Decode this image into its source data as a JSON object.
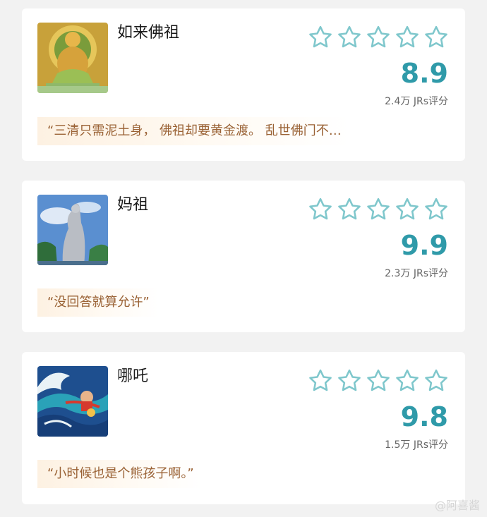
{
  "cards": [
    {
      "name": "如来佛祖",
      "score": "8.9",
      "rating_count": "2.4万 JRs评分",
      "quote": "“三清只需泥土身， 佛祖却要黄金渡。 乱世佛门不…",
      "stars_filled": 0,
      "stars_total": 5,
      "thumb_icon": "buddha-image"
    },
    {
      "name": "妈祖",
      "score": "9.9",
      "rating_count": "2.3万 JRs评分",
      "quote": "“没回答就算允许”",
      "stars_filled": 0,
      "stars_total": 5,
      "thumb_icon": "mazu-statue-image"
    },
    {
      "name": "哪吒",
      "score": "9.8",
      "rating_count": "1.5万 JRs评分",
      "quote": "“小时候也是个熊孩子啊。”",
      "stars_filled": 0,
      "stars_total": 5,
      "thumb_icon": "nezha-wave-image"
    }
  ],
  "colors": {
    "accent": "#2f9aa9",
    "star_outline": "#7fc7cc",
    "quote_text": "#9a6235",
    "quote_bg": "#fdf1e2",
    "page_bg": "#f2f2f2"
  },
  "watermark": "@阿喜酱"
}
